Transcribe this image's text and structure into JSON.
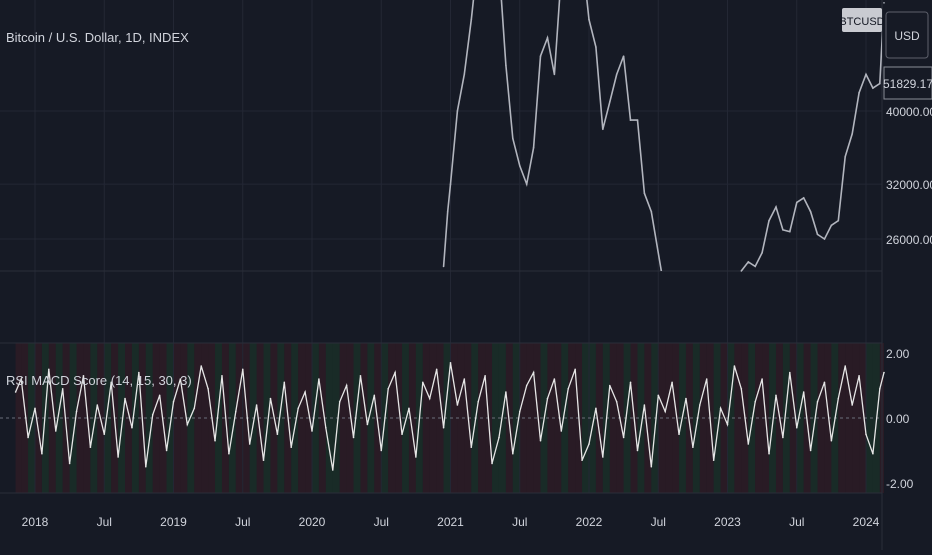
{
  "header": {
    "symbol_title": "Bitcoin / U.S. Dollar, 1D, INDEX",
    "ticker_badge": "BTCUSD",
    "currency_button": "USD",
    "last_price": "51829.17"
  },
  "price_axis": {
    "ticks": [
      {
        "value": 40000,
        "label": "40000.00"
      },
      {
        "value": 32000,
        "label": "32000.00"
      },
      {
        "value": 26000,
        "label": "26000.00"
      }
    ]
  },
  "indicator": {
    "label": "RSI MACD Score (14, 15, 30, 3)",
    "ticks": [
      {
        "value": 2,
        "label": "2.00"
      },
      {
        "value": 0,
        "label": "0.00"
      },
      {
        "value": -2,
        "label": "-2.00"
      }
    ]
  },
  "time_axis": {
    "labels": [
      {
        "t": 2018.0,
        "text": "2018"
      },
      {
        "t": 2018.5,
        "text": "Jul"
      },
      {
        "t": 2019.0,
        "text": "2019"
      },
      {
        "t": 2019.5,
        "text": "Jul"
      },
      {
        "t": 2020.0,
        "text": "2020"
      },
      {
        "t": 2020.5,
        "text": "Jul"
      },
      {
        "t": 2021.0,
        "text": "2021"
      },
      {
        "t": 2021.5,
        "text": "Jul"
      },
      {
        "t": 2022.0,
        "text": "2022"
      },
      {
        "t": 2022.5,
        "text": "Jul"
      },
      {
        "t": 2023.0,
        "text": "2023"
      },
      {
        "t": 2023.5,
        "text": "Jul"
      },
      {
        "t": 2024.0,
        "text": "2024"
      }
    ]
  },
  "colors": {
    "background": "#161a25",
    "grid": "#232734",
    "price_line": "#b2b5be",
    "score_line": "#e6e6e6",
    "bull_band": "#1e3a2a",
    "bear_band": "#3a1e26",
    "text": "#d1d4dc"
  },
  "chart_data": [
    {
      "type": "line",
      "title": "Bitcoin / U.S. Dollar, 1D, INDEX",
      "series": [
        {
          "name": "BTCUSD",
          "x": [
            2020.95,
            2020.98,
            2021.0,
            2021.05,
            2021.1,
            2021.15,
            2021.2,
            2021.25,
            2021.3,
            2021.35,
            2021.4,
            2021.45,
            2021.5,
            2021.55,
            2021.6,
            2021.65,
            2021.7,
            2021.75,
            2021.8,
            2021.85,
            2021.9,
            2021.95,
            2022.0,
            2022.05,
            2022.1,
            2022.15,
            2022.2,
            2022.25,
            2022.3,
            2022.35,
            2022.4,
            2022.45,
            2022.55,
            2022.65,
            2022.75,
            2022.85,
            2022.95,
            2023.0,
            2023.05,
            2023.1,
            2023.15,
            2023.2,
            2023.25,
            2023.3,
            2023.35,
            2023.4,
            2023.45,
            2023.5,
            2023.55,
            2023.6,
            2023.65,
            2023.7,
            2023.75,
            2023.8,
            2023.85,
            2023.9,
            2023.95,
            2024.0,
            2024.05,
            2024.1,
            2024.13
          ],
          "y": [
            23000,
            29000,
            32000,
            40000,
            44000,
            50000,
            57000,
            58000,
            59000,
            56000,
            45000,
            37000,
            34000,
            32000,
            36000,
            46000,
            48000,
            44000,
            55000,
            61000,
            64000,
            57000,
            50000,
            47000,
            38000,
            41000,
            44000,
            46000,
            39000,
            39000,
            31000,
            29000,
            20000,
            22000,
            19500,
            20000,
            16800,
            16500,
            17500,
            22500,
            23500,
            23000,
            24500,
            28000,
            29500,
            27000,
            26800,
            30000,
            30500,
            29000,
            26500,
            26000,
            27500,
            28000,
            35000,
            37500,
            42000,
            44000,
            42500,
            43000,
            51829
          ]
        }
      ],
      "yticks": [
        26000,
        32000,
        40000
      ]
    },
    {
      "type": "line",
      "title": "RSI MACD Score (14, 15, 30, 3)",
      "ylim": [
        -2,
        2
      ],
      "yticks": [
        -2,
        0,
        2
      ],
      "xticks": [
        "2018",
        "Jul",
        "2019",
        "Jul",
        "2020",
        "Jul",
        "2021",
        "Jul",
        "2022",
        "Jul",
        "2023",
        "Jul",
        "2024"
      ],
      "series": [
        {
          "name": "RSI MACD Score",
          "x": [
            2017.86,
            2017.9,
            2017.95,
            2018.0,
            2018.05,
            2018.1,
            2018.15,
            2018.2,
            2018.25,
            2018.3,
            2018.35,
            2018.4,
            2018.45,
            2018.5,
            2018.55,
            2018.6,
            2018.65,
            2018.7,
            2018.75,
            2018.8,
            2018.85,
            2018.9,
            2018.95,
            2019.0,
            2019.05,
            2019.1,
            2019.15,
            2019.2,
            2019.25,
            2019.3,
            2019.35,
            2019.4,
            2019.45,
            2019.5,
            2019.55,
            2019.6,
            2019.65,
            2019.7,
            2019.75,
            2019.8,
            2019.85,
            2019.9,
            2019.95,
            2020.0,
            2020.05,
            2020.1,
            2020.15,
            2020.2,
            2020.25,
            2020.3,
            2020.35,
            2020.4,
            2020.45,
            2020.5,
            2020.55,
            2020.6,
            2020.65,
            2020.7,
            2020.75,
            2020.8,
            2020.85,
            2020.9,
            2020.95,
            2021.0,
            2021.05,
            2021.1,
            2021.15,
            2021.2,
            2021.25,
            2021.3,
            2021.35,
            2021.4,
            2021.45,
            2021.5,
            2021.55,
            2021.6,
            2021.65,
            2021.7,
            2021.75,
            2021.8,
            2021.85,
            2021.9,
            2021.95,
            2022.0,
            2022.05,
            2022.1,
            2022.15,
            2022.2,
            2022.25,
            2022.3,
            2022.35,
            2022.4,
            2022.45,
            2022.5,
            2022.55,
            2022.6,
            2022.65,
            2022.7,
            2022.75,
            2022.8,
            2022.85,
            2022.9,
            2022.95,
            2023.0,
            2023.05,
            2023.1,
            2023.15,
            2023.2,
            2023.25,
            2023.3,
            2023.35,
            2023.4,
            2023.45,
            2023.5,
            2023.55,
            2023.6,
            2023.65,
            2023.7,
            2023.75,
            2023.8,
            2023.85,
            2023.9,
            2023.95,
            2024.0,
            2024.05,
            2024.1,
            2024.13
          ],
          "y": [
            0.8,
            1.2,
            -0.6,
            0.3,
            -1.1,
            1.5,
            -0.4,
            0.9,
            -1.4,
            0.2,
            1.3,
            -0.9,
            0.4,
            -0.5,
            1.1,
            -1.2,
            0.6,
            -0.3,
            1.4,
            -1.5,
            0.1,
            0.7,
            -1.0,
            0.5,
            1.2,
            -0.2,
            0.3,
            1.6,
            0.9,
            -0.7,
            1.3,
            -1.1,
            0.2,
            1.5,
            -0.8,
            0.4,
            -1.3,
            0.6,
            -0.5,
            1.1,
            -0.9,
            0.3,
            0.8,
            -0.4,
            1.2,
            -0.3,
            -1.6,
            0.5,
            1.0,
            -0.6,
            1.3,
            -0.2,
            0.7,
            -1.0,
            0.9,
            1.4,
            -0.5,
            0.3,
            -1.2,
            1.1,
            0.6,
            1.5,
            -0.3,
            1.7,
            0.4,
            1.2,
            -0.9,
            0.5,
            1.3,
            -1.4,
            -0.6,
            0.8,
            -1.1,
            0.2,
            1.0,
            1.4,
            -0.7,
            0.6,
            1.2,
            -0.4,
            0.9,
            1.5,
            -1.3,
            -0.8,
            0.3,
            -1.2,
            1.0,
            0.5,
            -0.6,
            1.1,
            -1.0,
            0.4,
            -1.5,
            0.7,
            0.2,
            1.1,
            -0.5,
            0.6,
            -0.9,
            0.4,
            1.2,
            -1.3,
            0.3,
            -0.2,
            1.6,
            0.9,
            -0.8,
            0.5,
            1.2,
            -1.1,
            0.7,
            -0.6,
            1.4,
            -0.3,
            0.8,
            -1.0,
            0.5,
            1.1,
            -0.7,
            0.6,
            1.6,
            0.4,
            1.3,
            -0.5,
            -1.1,
            0.9,
            1.4
          ]
        }
      ]
    }
  ]
}
